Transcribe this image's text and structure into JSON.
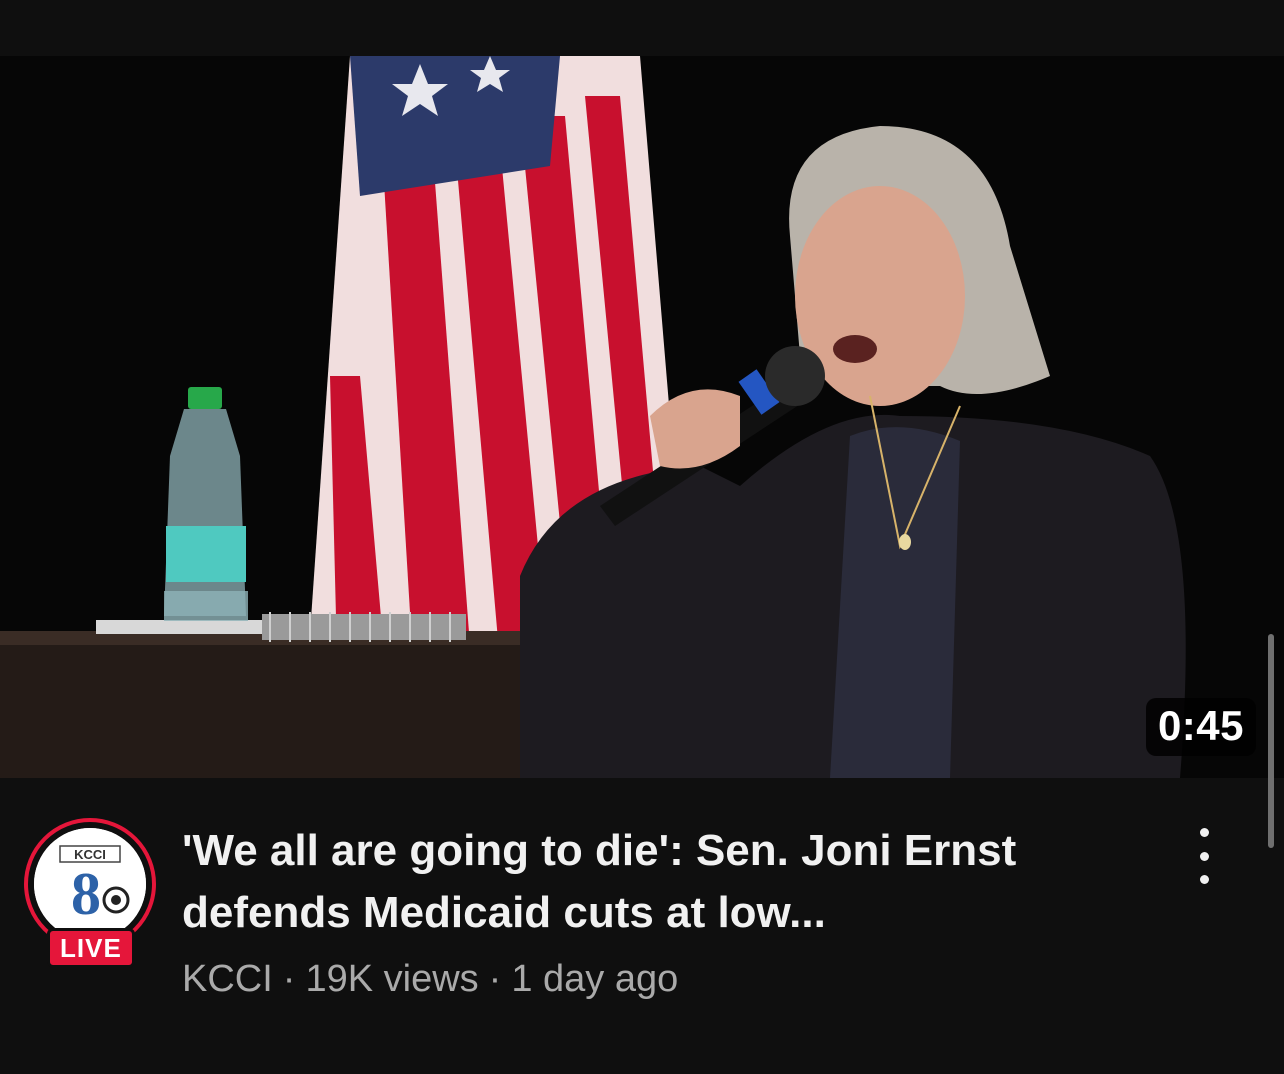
{
  "video": {
    "duration": "0:45",
    "title": "'We all are going to die': Sen. Joni Ernst defends Medicaid cuts at low...",
    "channel": "KCCI",
    "views": "19K views",
    "age": "1 day ago",
    "separator": "·"
  },
  "channel_avatar": {
    "logo_text": "KCCI",
    "logo_number": "8",
    "live_badge": "LIVE"
  },
  "icons": {
    "menu": "more-vert-icon"
  },
  "colors": {
    "background": "#0f0f0f",
    "live_red": "#e5163a",
    "secondary_text": "#aaaaaa",
    "primary_text": "#f1f1f1"
  }
}
